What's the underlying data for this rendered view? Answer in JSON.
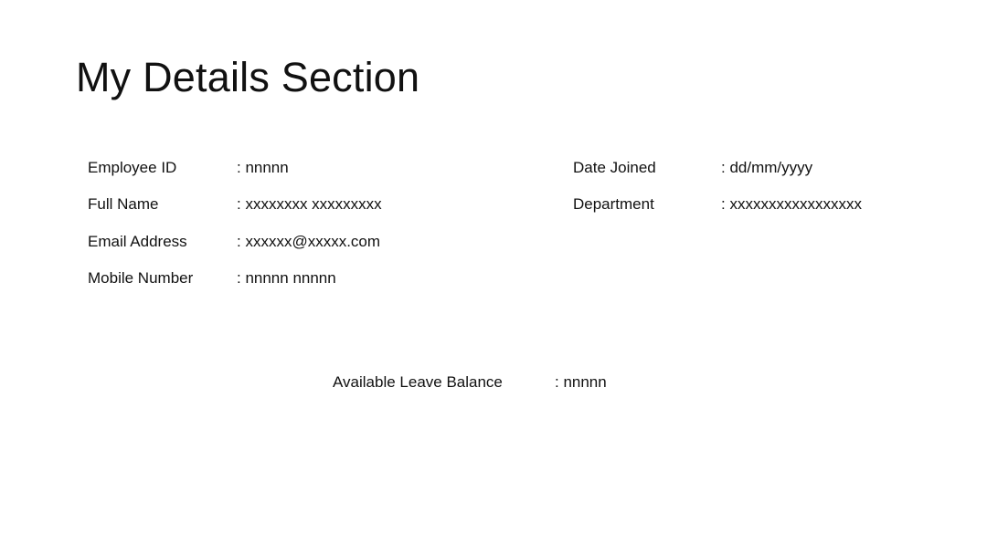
{
  "title": "My Details Section",
  "left_fields": [
    {
      "label": "Employee ID",
      "value": ": nnnnn"
    },
    {
      "label": "Full Name",
      "value": ": xxxxxxxx xxxxxxxxx"
    },
    {
      "label": "Email Address",
      "value": ": xxxxxx@xxxxx.com"
    },
    {
      "label": "Mobile Number",
      "value": ": nnnnn nnnnn"
    }
  ],
  "right_fields": [
    {
      "label": "Date Joined",
      "value": ": dd/mm/yyyy"
    },
    {
      "label": "Department",
      "value": ": xxxxxxxxxxxxxxxxx"
    }
  ],
  "leave_balance": {
    "label": "Available Leave Balance",
    "value": ": nnnnn"
  }
}
